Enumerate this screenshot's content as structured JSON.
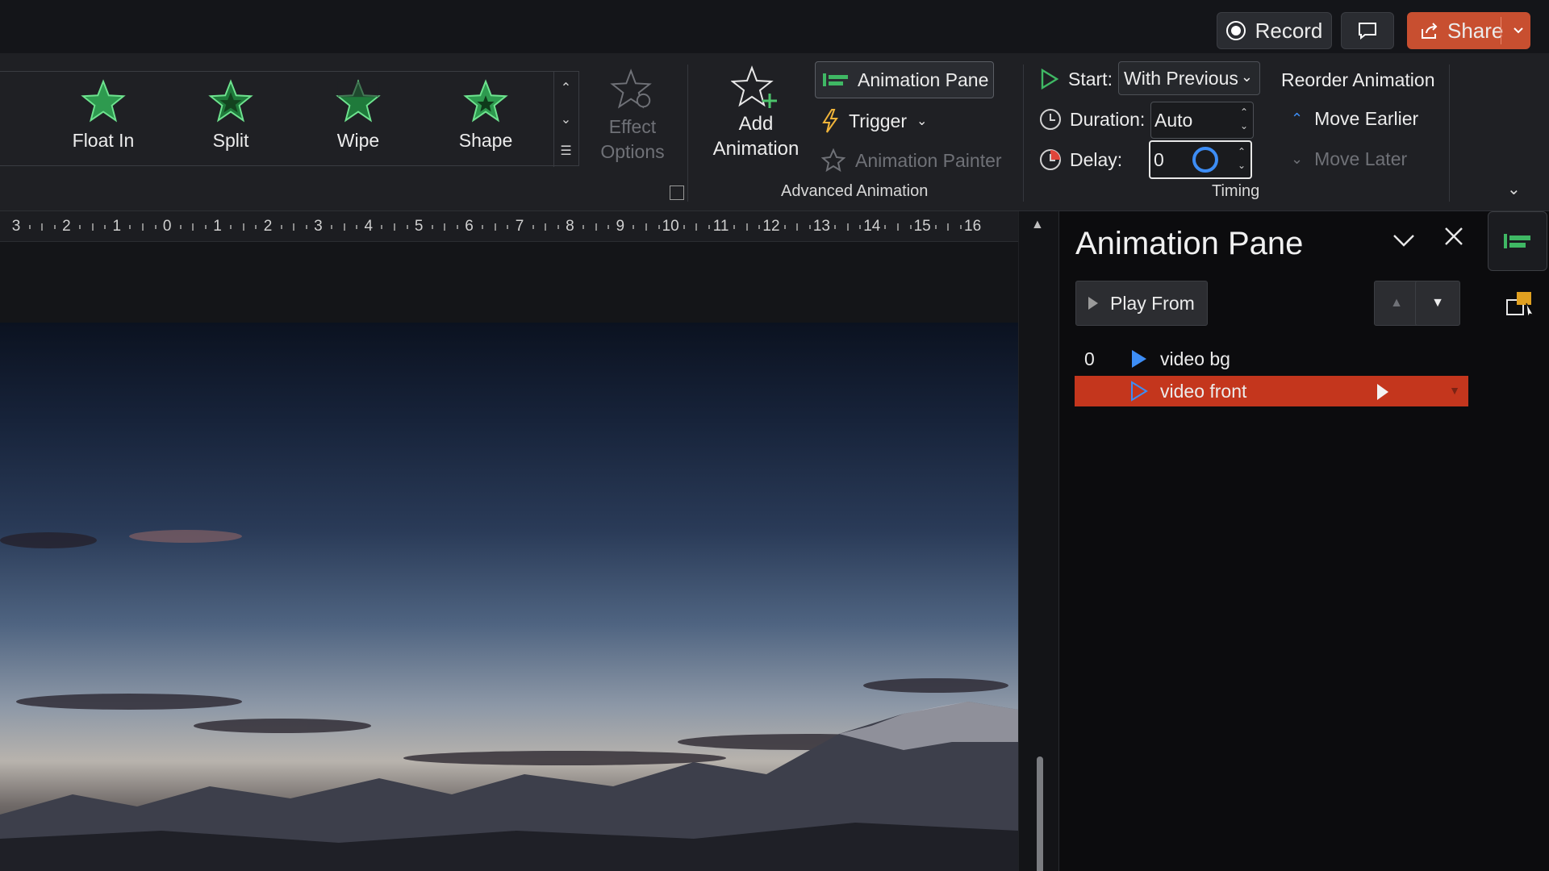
{
  "titlebar": {
    "record_label": "Record",
    "share_label": "Share"
  },
  "ribbon": {
    "animations": [
      {
        "label": "Float In"
      },
      {
        "label": "Split"
      },
      {
        "label": "Wipe"
      },
      {
        "label": "Shape"
      }
    ],
    "effect_options": {
      "line1": "Effect",
      "line2": "Options"
    },
    "add_animation": {
      "line1": "Add",
      "line2": "Animation"
    },
    "animation_pane_label": "Animation Pane",
    "trigger_label": "Trigger",
    "animation_painter_label": "Animation Painter",
    "advanced_group_label": "Advanced Animation",
    "timing": {
      "start_label": "Start:",
      "start_value": "With Previous",
      "duration_label": "Duration:",
      "duration_value": "Auto",
      "delay_label": "Delay:",
      "delay_value": "0",
      "group_label": "Timing"
    },
    "reorder": {
      "title": "Reorder Animation",
      "move_earlier": "Move Earlier",
      "move_later": "Move Later"
    }
  },
  "ruler": {
    "numbers": [
      "3",
      "2",
      "1",
      "0",
      "1",
      "2",
      "3",
      "4",
      "5",
      "6",
      "7",
      "8",
      "9",
      "10",
      "11",
      "12",
      "13",
      "14",
      "15",
      "16"
    ]
  },
  "animation_pane": {
    "title": "Animation Pane",
    "play_from_label": "Play From",
    "items": [
      {
        "number": "0",
        "label": "video bg",
        "selected": false
      },
      {
        "number": "",
        "label": "video front",
        "selected": true
      }
    ]
  },
  "colors": {
    "accent_green": "#2e9a4f",
    "share_orange": "#c84f30",
    "selection_red": "#c4361d",
    "cursor_blue": "#3d8df5"
  }
}
